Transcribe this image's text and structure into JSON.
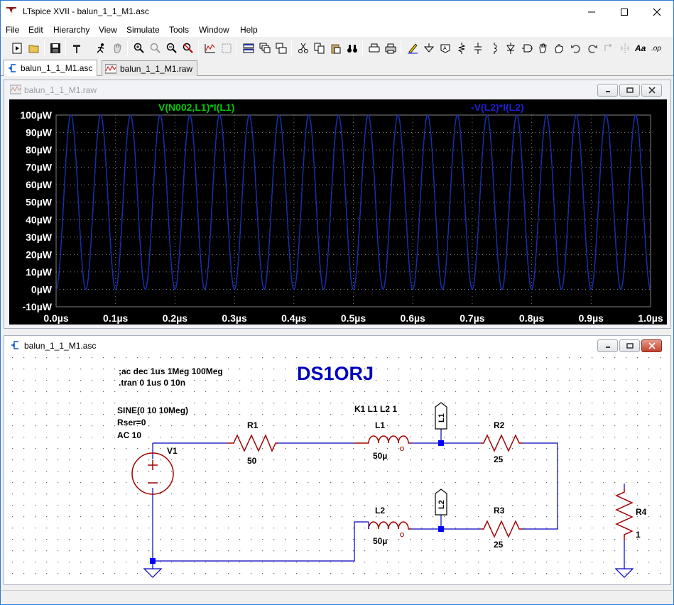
{
  "window": {
    "title": "LTspice XVII - balun_1_1_M1.asc"
  },
  "menu": [
    "File",
    "Edit",
    "Hierarchy",
    "View",
    "Simulate",
    "Tools",
    "Window",
    "Help"
  ],
  "tabs": [
    {
      "label": "balun_1_1_M1.asc",
      "icon": "schematic-icon"
    },
    {
      "label": "balun_1_1_M1.raw",
      "icon": "waveform-icon"
    }
  ],
  "waveform_window": {
    "title": "balun_1_1_M1.raw",
    "colors": {
      "background": "#000000",
      "trace_a": "#00c800",
      "trace_b": "#1f1fd0",
      "axis_text": "#ffffff",
      "grid": "#808080"
    }
  },
  "chart_data": {
    "type": "line",
    "title": "",
    "legend": [
      "V(N002,L1)*I(L1)",
      "-V(L2)*I(L2)"
    ],
    "xlabel": "",
    "ylabel": "",
    "x_ticks": [
      "0.0µs",
      "0.1µs",
      "0.2µs",
      "0.3µs",
      "0.4µs",
      "0.5µs",
      "0.6µs",
      "0.7µs",
      "0.8µs",
      "0.9µs",
      "1.0µs"
    ],
    "y_ticks": [
      "100µW",
      "90µW",
      "80µW",
      "70µW",
      "60µW",
      "50µW",
      "40µW",
      "30µW",
      "20µW",
      "10µW",
      "0µW",
      "-10µW"
    ],
    "xlim": [
      0,
      1.0
    ],
    "ylim": [
      -10,
      100
    ],
    "grid": "dotted",
    "series": [
      {
        "name": "V(N002,L1)*I(L1)",
        "color": "#00c800",
        "shape": "sin^2",
        "frequency_mhz": 20,
        "min": 0,
        "max": 100
      },
      {
        "name": "-V(L2)*I(L2)",
        "color": "#1f1fd0",
        "shape": "sin^2",
        "frequency_mhz": 20,
        "min": 0,
        "max": 100
      }
    ]
  },
  "schematic_window": {
    "title": "balun_1_1_M1.asc",
    "directives": [
      ";ac dec 1us 1Meg 100Meg",
      ".tran 0 1us 0 10n"
    ],
    "call_sign": "DS1ORJ",
    "source": {
      "name": "V1",
      "params": [
        "SINE(0 10 10Meg)",
        "Rser=0",
        "AC 10"
      ]
    },
    "coupling": "K1 L1 L2 1",
    "components": {
      "R1": {
        "name": "R1",
        "value": "50"
      },
      "L1": {
        "name": "L1",
        "value": "50µ"
      },
      "L2": {
        "name": "L2",
        "value": "50µ"
      },
      "R2": {
        "name": "R2",
        "value": "25"
      },
      "R3": {
        "name": "R3",
        "value": "25"
      },
      "R4": {
        "name": "R4",
        "value": "1"
      }
    },
    "net_labels": [
      "L1",
      "L2"
    ],
    "colors": {
      "wire": "#0000c0",
      "component": "#a00000",
      "text": "#000000",
      "title": "#0000c0",
      "junction": "#0000ff"
    }
  }
}
